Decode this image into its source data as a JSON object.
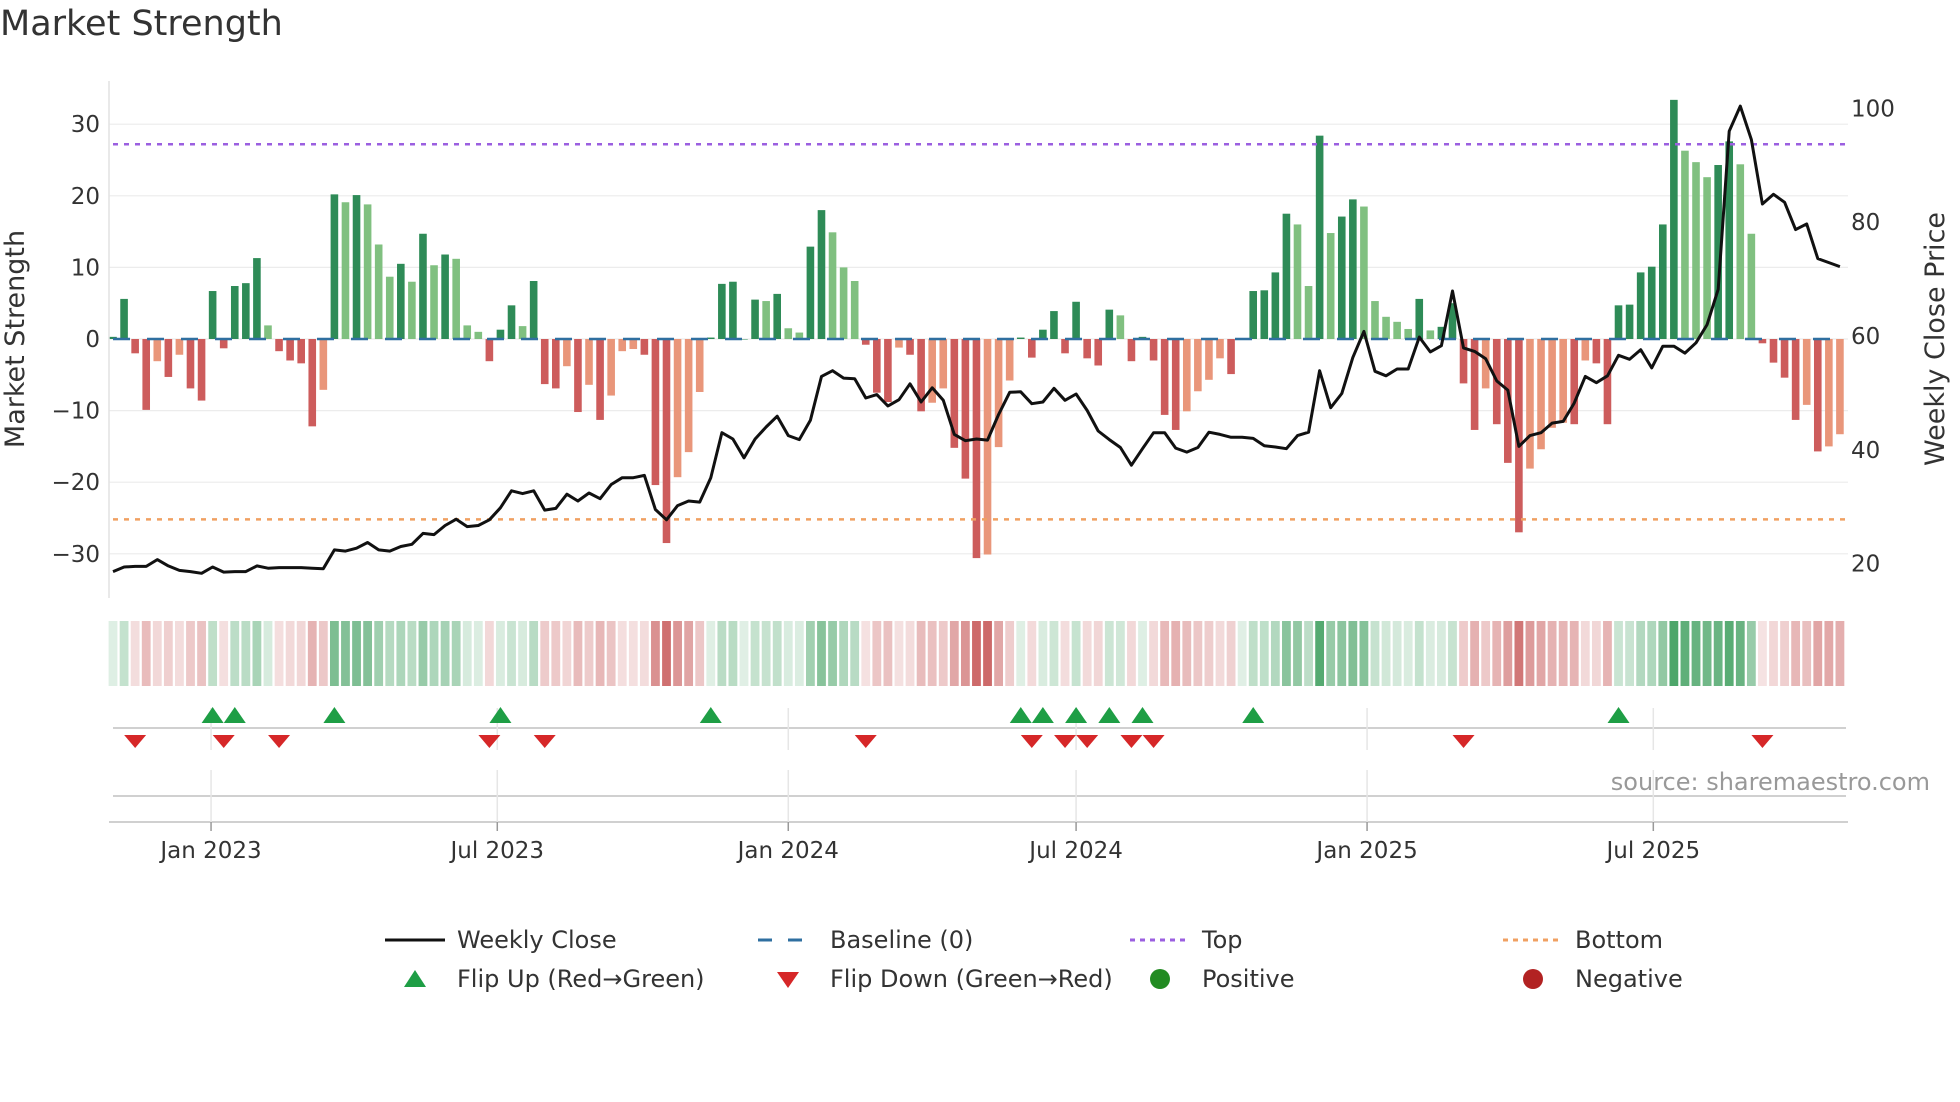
{
  "title": "Market Strength",
  "source": "source: sharemaestro.com",
  "legend": {
    "weekly_close": "Weekly Close",
    "baseline": "Baseline (0)",
    "top": "Top",
    "bottom": "Bottom",
    "flip_up": "Flip Up (Red→Green)",
    "flip_down": "Flip Down (Green→Red)",
    "positive": "Positive",
    "negative": "Negative"
  },
  "colors": {
    "strong_green": "#2e8b57",
    "weak_green": "#80c080",
    "strong_red": "#cd5c5c",
    "weak_red": "#e9967a",
    "baseline": "#2f6fa0",
    "top": "#9b5fe0",
    "bottom": "#f0a062",
    "price": "#111111",
    "flip_up": "#1e9e45",
    "flip_down": "#d62728",
    "positive": "#228b22",
    "negative": "#b22222"
  },
  "chart_data": {
    "type": "bar",
    "title": "Market Strength",
    "xlabel": "",
    "ylabel": "Market Strength",
    "y2label": "Weekly Close Price",
    "start_date": "2022-10-31",
    "frequency": "weekly",
    "ylim": [
      -36,
      36
    ],
    "y2lim": [
      15.5,
      105
    ],
    "yticks": [
      -30,
      -20,
      -10,
      0,
      10,
      20,
      30
    ],
    "ytick_labels": [
      "−30",
      "−20",
      "−10",
      "0",
      "10",
      "20",
      "30"
    ],
    "y2ticks": [
      20,
      40,
      60,
      80,
      100
    ],
    "y2tick_labels": [
      "20",
      "40",
      "60",
      "80",
      "100"
    ],
    "xticks": [
      {
        "date": "2023-01-01",
        "label": "Jan 2023"
      },
      {
        "date": "2023-07-01",
        "label": "Jul 2023"
      },
      {
        "date": "2024-01-01",
        "label": "Jan 2024"
      },
      {
        "date": "2024-07-01",
        "label": "Jul 2024"
      },
      {
        "date": "2025-01-01",
        "label": "Jan 2025"
      },
      {
        "date": "2025-07-01",
        "label": "Jul 2025"
      }
    ],
    "top_level": 27.2,
    "bottom_level": -25.2,
    "strength": [
      0.3,
      5.6,
      -2,
      -9.9,
      -3.1,
      -5.3,
      -2.2,
      -6.9,
      -8.6,
      6.7,
      -1.3,
      7.4,
      7.8,
      11.3,
      1.9,
      -1.7,
      -3,
      -3.4,
      -12.2,
      -7.1,
      20.2,
      19.1,
      20.1,
      18.8,
      13.2,
      8.7,
      10.5,
      8.0,
      14.7,
      10.3,
      11.8,
      11.2,
      1.9,
      1.0,
      -3.1,
      1.3,
      4.7,
      1.8,
      8.1,
      -6.3,
      -6.9,
      -3.8,
      -10.2,
      -6.4,
      -11.3,
      -7.9,
      -1.7,
      -1.4,
      -2.2,
      -20.4,
      -28.5,
      -19.3,
      -15.8,
      -7.4,
      0.2,
      7.7,
      8.0,
      0,
      5.5,
      5.3,
      6.3,
      1.5,
      0.9,
      12.9,
      18.0,
      14.9,
      10.0,
      8.1,
      -0.8,
      -7.5,
      -8.8,
      -1.2,
      -2.2,
      -10.1,
      -8.9,
      -6.9,
      -15.2,
      -19.5,
      -30.6,
      -30.1,
      -15.1,
      -5.8,
      0.2,
      -2.6,
      1.3,
      3.9,
      -2.0,
      5.2,
      -2.7,
      -3.7,
      4.1,
      3.3,
      -3.1,
      0.3,
      -3.0,
      -10.6,
      -12.7,
      -10.1,
      -7.3,
      -5.7,
      -2.7,
      -4.9,
      0,
      6.7,
      6.8,
      9.3,
      17.5,
      16.0,
      7.4,
      28.4,
      14.8,
      17.1,
      19.5,
      18.5,
      5.3,
      3.1,
      2.4,
      1.4,
      5.6,
      1.2,
      1.7,
      5.0,
      -6.2,
      -12.7,
      -6.9,
      -11.9,
      -17.3,
      -27.0,
      -18.1,
      -15.4,
      -12.4,
      -11.7,
      -11.9,
      -3.0,
      -3.4,
      -11.9,
      4.7,
      4.8,
      9.3,
      10.1,
      16.0,
      33.4,
      26.3,
      24.7,
      22.6,
      24.3,
      27.6,
      24.4,
      14.7,
      -0.6,
      -3.3,
      -5.4,
      -11.3,
      -9.2,
      -15.7,
      -15.0,
      -13.3
    ],
    "weekly_close": [
      18.6,
      19.4,
      19.5,
      19.5,
      20.7,
      19.6,
      18.8,
      18.6,
      18.3,
      19.4,
      18.5,
      18.6,
      18.6,
      19.6,
      19.2,
      19.3,
      19.3,
      19.3,
      19.2,
      19.1,
      22.4,
      22.2,
      22.7,
      23.7,
      22.4,
      22.2,
      23.0,
      23.4,
      25.3,
      25.1,
      26.7,
      27.8,
      26.5,
      26.7,
      27.7,
      29.8,
      32.8,
      32.3,
      32.8,
      29.4,
      29.7,
      32.2,
      31.0,
      32.4,
      31.4,
      33.9,
      35.1,
      35.1,
      35.5,
      29.5,
      27.7,
      30.2,
      31.0,
      30.8,
      35.1,
      43.0,
      41.9,
      38.6,
      41.9,
      44.0,
      45.9,
      42.5,
      41.8,
      45.2,
      52.9,
      53.9,
      52.6,
      52.5,
      49.1,
      49.7,
      47.7,
      48.8,
      51.6,
      48.4,
      50.9,
      48.7,
      42.7,
      41.6,
      41.9,
      41.7,
      46.2,
      50.1,
      50.2,
      48.1,
      48.4,
      50.8,
      48.7,
      49.8,
      46.9,
      43.3,
      41.8,
      40.4,
      37.3,
      40.2,
      43.0,
      43.0,
      40.3,
      39.6,
      40.4,
      43.1,
      42.7,
      42.2,
      42.2,
      42.0,
      40.7,
      40.5,
      40.2,
      42.5,
      43.1,
      53.9,
      47.4,
      49.9,
      56.2,
      60.8,
      53.8,
      53.0,
      54.2,
      54.2,
      59.8,
      57.2,
      58.3,
      67.9,
      57.9,
      57.3,
      56.0,
      52.1,
      50.5,
      40.6,
      42.5,
      43.0,
      44.7,
      45.0,
      48.2,
      52.9,
      51.8,
      53.0,
      56.6,
      55.9,
      57.6,
      54.4,
      58.2,
      58.2,
      57.0,
      58.8,
      62.0,
      68.2,
      96.0,
      100.4,
      94.5,
      83.2,
      84.9,
      83.5,
      78.7,
      79.7,
      73.6,
      72.9,
      72.2
    ],
    "flip_up_weeks": [
      9,
      11,
      20,
      35,
      54,
      82,
      84,
      87,
      90,
      93,
      103,
      136
    ],
    "flip_down_weeks": [
      2,
      10,
      15,
      34,
      39,
      68,
      83,
      86,
      88,
      92,
      94,
      122,
      149
    ],
    "legend_position": "bottom-center"
  }
}
